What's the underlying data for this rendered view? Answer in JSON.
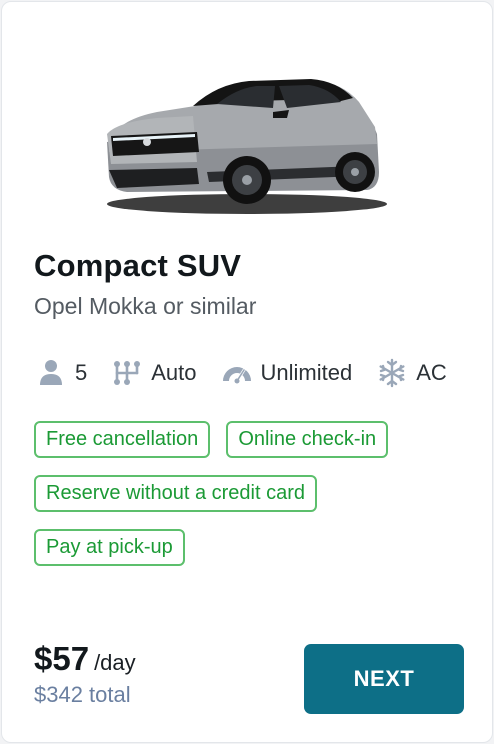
{
  "car": {
    "title": "Compact SUV",
    "subtitle": "Opel Mokka or similar",
    "image_icon": "car-image"
  },
  "specs": [
    {
      "icon": "person-icon",
      "label": "5"
    },
    {
      "icon": "transmission-icon",
      "label": "Auto"
    },
    {
      "icon": "speedometer-icon",
      "label": "Unlimited"
    },
    {
      "icon": "snowflake-icon",
      "label": "AC"
    }
  ],
  "badges": [
    "Free cancellation",
    "Online check-in",
    "Reserve without a credit card",
    "Pay at pick-up"
  ],
  "pricing": {
    "price": "$57",
    "unit": "/day",
    "total": "$342 total"
  },
  "action": {
    "next_label": "NEXT"
  },
  "colors": {
    "badge_border": "#5cbf6c",
    "badge_text": "#1b9a35",
    "button_bg": "#0d6f87",
    "icon_gray": "#9aa7b8"
  }
}
